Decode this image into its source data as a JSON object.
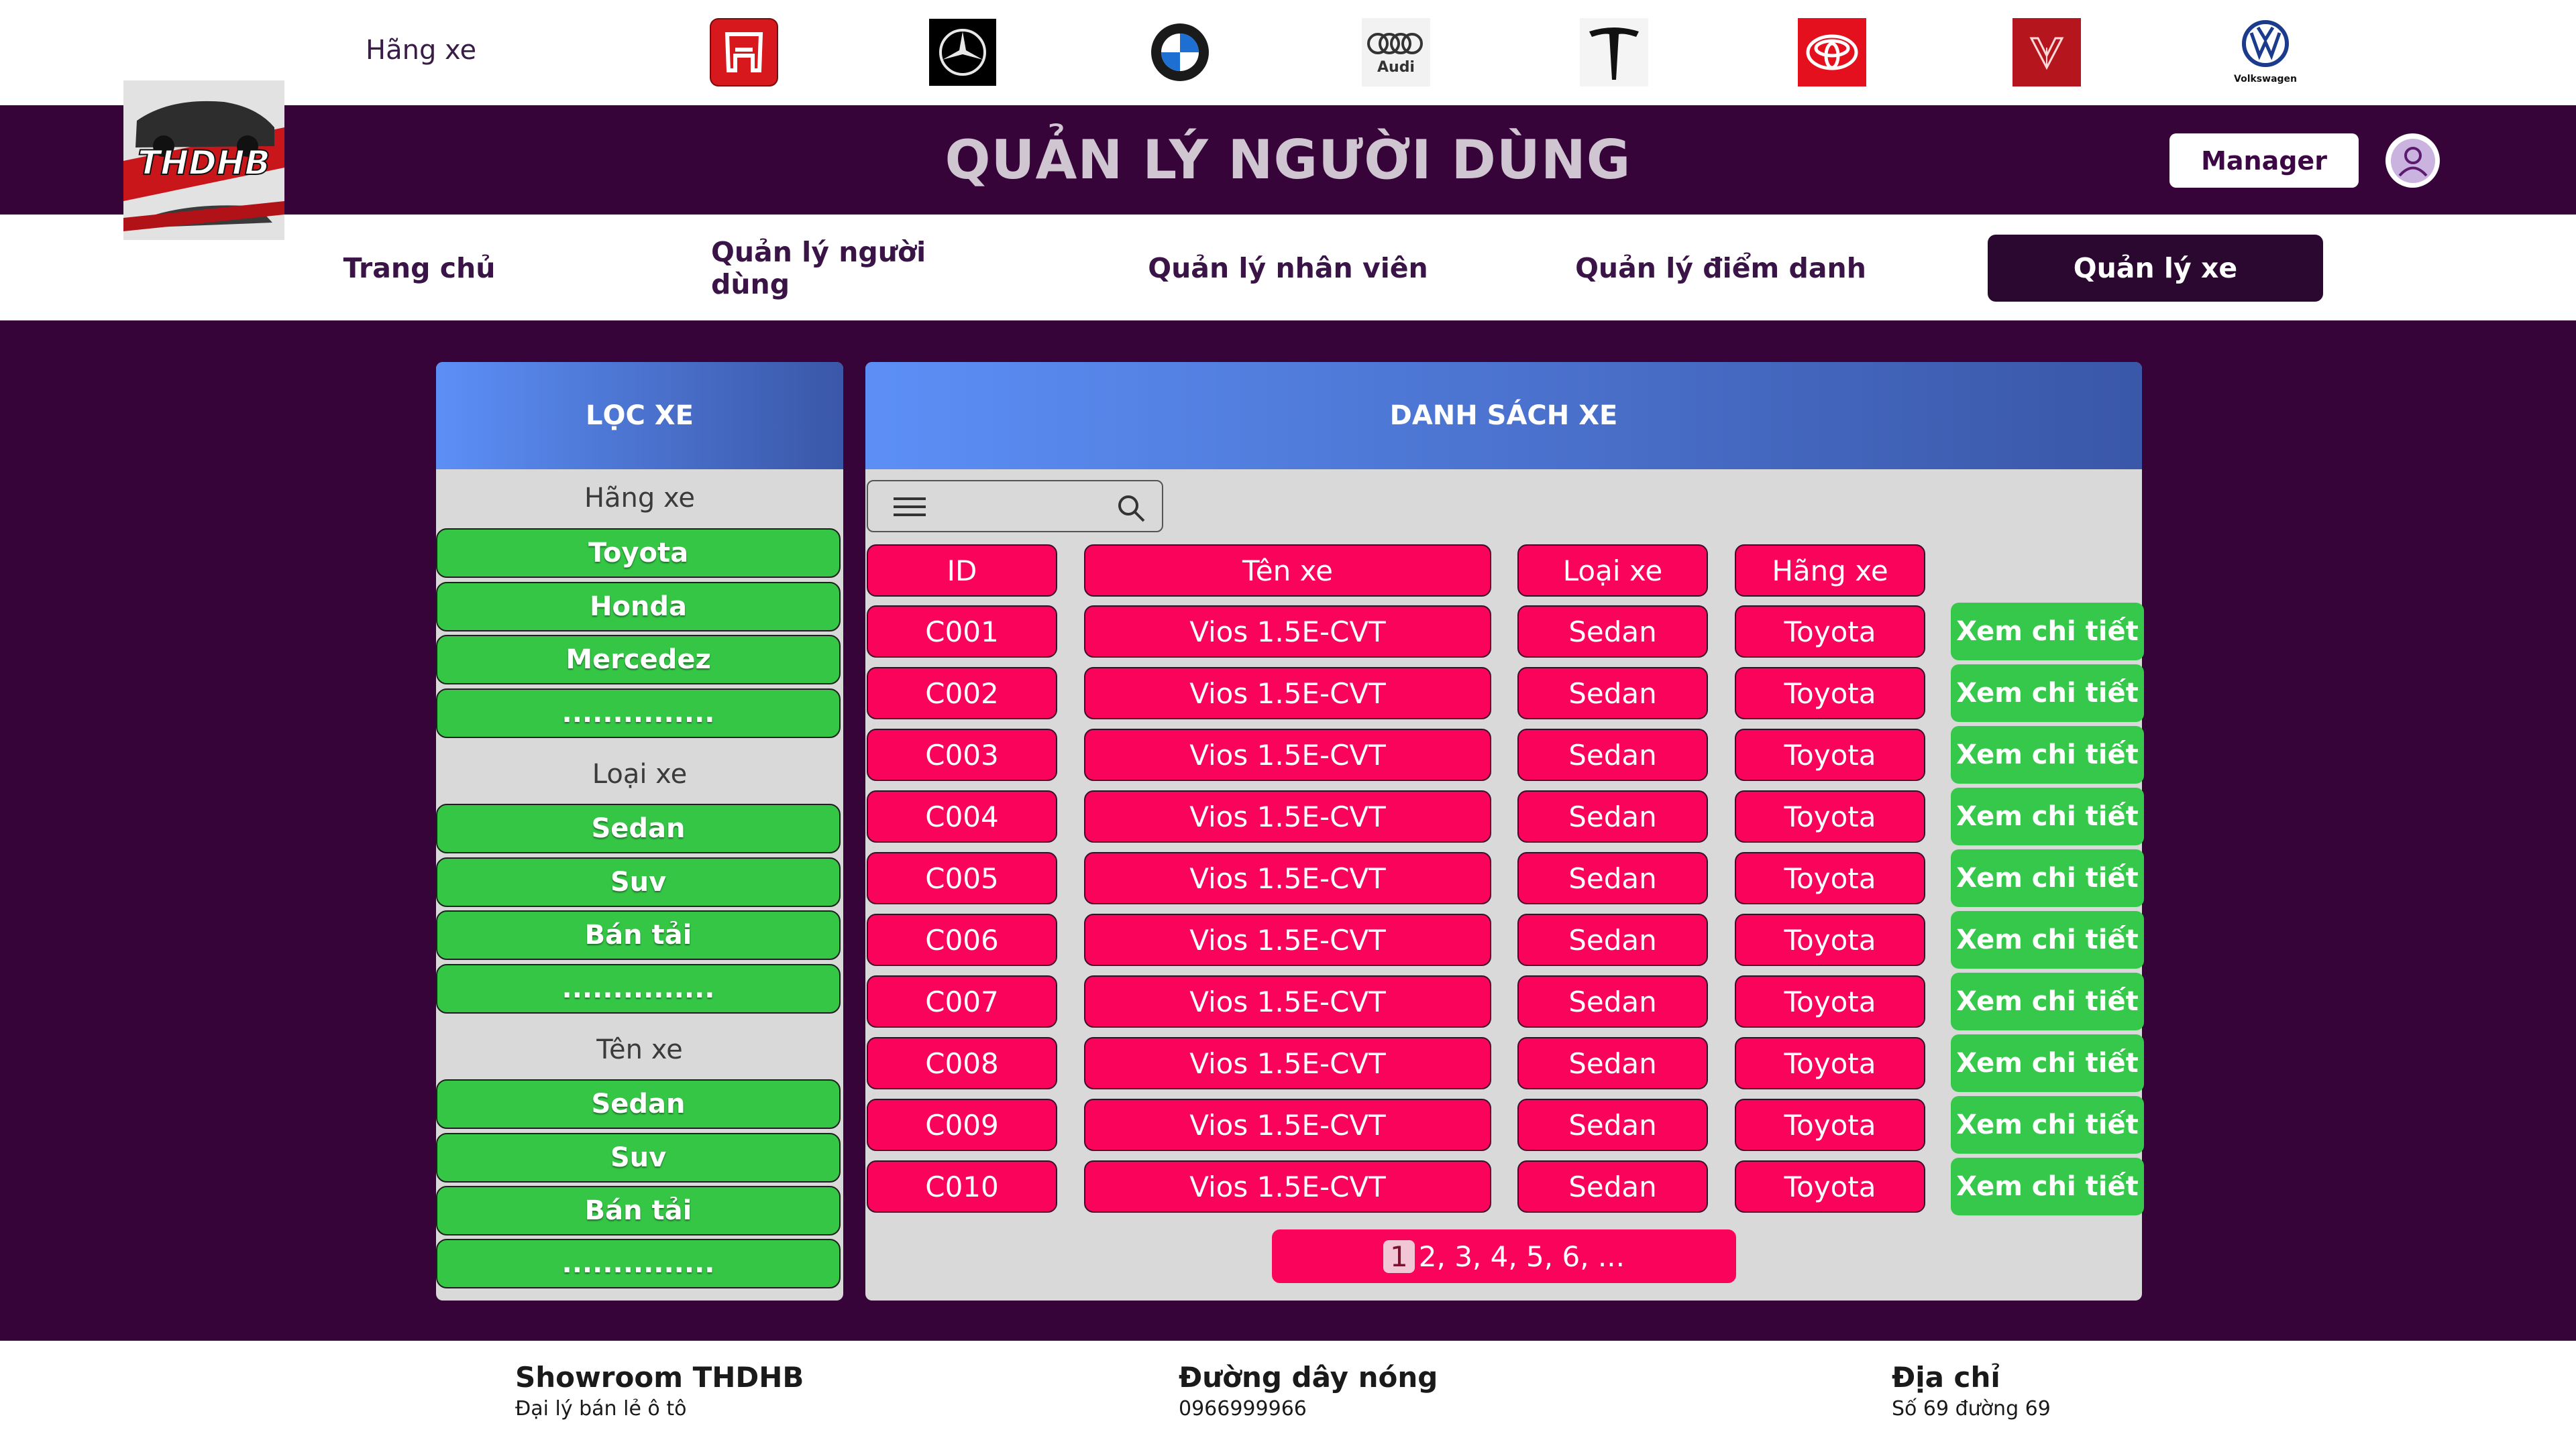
{
  "brand_strip": {
    "label": "Hãng xe",
    "brands": [
      "honda-logo",
      "mercedes-logo",
      "bmw-logo",
      "audi-logo",
      "tesla-logo",
      "toyota-logo",
      "vinfast-logo",
      "volkswagen-logo"
    ],
    "audi_text": "Audi",
    "vw_text": "Volkswagen"
  },
  "header": {
    "title": "QUẢN LÝ NGƯỜI DÙNG",
    "manager_label": "Manager",
    "logo_text": "THDHB"
  },
  "nav": {
    "items": [
      "Trang chủ",
      "Quản lý người dùng",
      "Quản lý nhân viên",
      "Quản lý điểm danh",
      "Quản lý xe"
    ],
    "active": "Quản lý xe"
  },
  "filter": {
    "title": "LỌC XE",
    "groups": [
      {
        "title": "Hãng xe",
        "options": [
          "Toyota",
          "Honda",
          "Mercedez",
          "..............."
        ]
      },
      {
        "title": "Loại xe",
        "options": [
          "Sedan",
          "Suv",
          "Bán tải",
          "..............."
        ]
      },
      {
        "title": "Tên xe",
        "options": [
          "Sedan",
          "Suv",
          "Bán tải",
          "..............."
        ]
      }
    ]
  },
  "car_list": {
    "title": "DANH SÁCH XE",
    "columns": [
      "ID",
      "Tên xe",
      "Loại xe",
      "Hãng xe"
    ],
    "detail_label": "Xem chi tiết",
    "rows": [
      [
        "C001",
        "Vios 1.5E-CVT",
        "Sedan",
        "Toyota"
      ],
      [
        "C002",
        "Vios 1.5E-CVT",
        "Sedan",
        "Toyota"
      ],
      [
        "C003",
        "Vios 1.5E-CVT",
        "Sedan",
        "Toyota"
      ],
      [
        "C004",
        "Vios 1.5E-CVT",
        "Sedan",
        "Toyota"
      ],
      [
        "C005",
        "Vios 1.5E-CVT",
        "Sedan",
        "Toyota"
      ],
      [
        "C006",
        "Vios 1.5E-CVT",
        "Sedan",
        "Toyota"
      ],
      [
        "C007",
        "Vios 1.5E-CVT",
        "Sedan",
        "Toyota"
      ],
      [
        "C008",
        "Vios 1.5E-CVT",
        "Sedan",
        "Toyota"
      ],
      [
        "C009",
        "Vios 1.5E-CVT",
        "Sedan",
        "Toyota"
      ],
      [
        "C010",
        "Vios 1.5E-CVT",
        "Sedan",
        "Toyota"
      ]
    ],
    "pager": {
      "current": "1",
      "rest": "2, 3, 4, 5, 6, ..."
    }
  },
  "footer": {
    "showroom_title": "Showroom THDHB",
    "showroom_text": "Đại lý bán lẻ ô tô",
    "hotline_title": "Đường dây nóng",
    "hotline_text": "0966999966",
    "address_title": "Địa chỉ",
    "address_text": "Số 69 đường 69"
  },
  "colors": {
    "background": "#37043a",
    "row_pink": "#f9035b",
    "button_green": "#36c84a",
    "header_blue": "#5c8ff6"
  }
}
